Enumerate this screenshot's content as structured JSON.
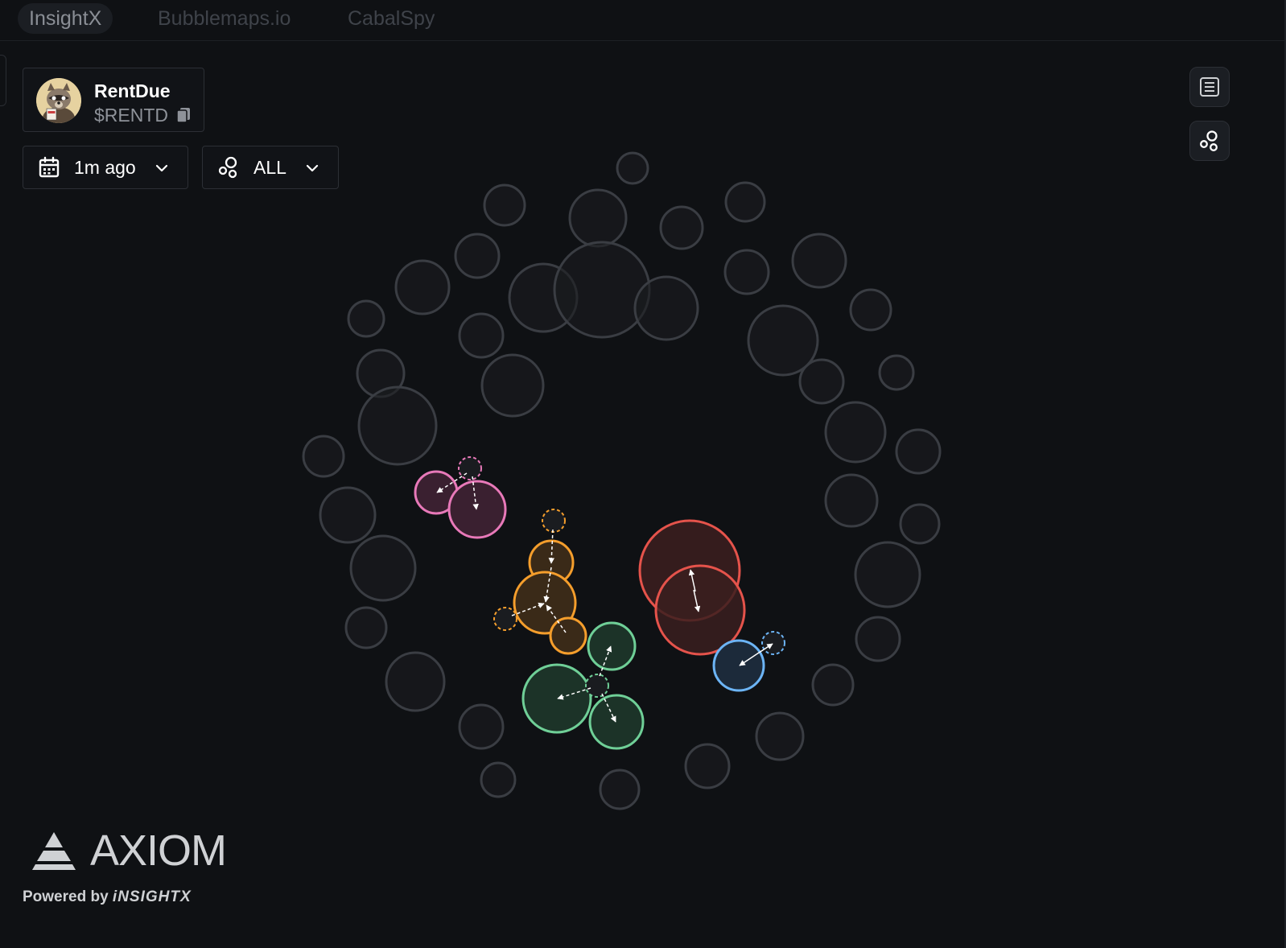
{
  "tabs": [
    {
      "label": "InsightX",
      "active": true
    },
    {
      "label": "Bubblemaps.io",
      "active": false
    },
    {
      "label": "CabalSpy",
      "active": false
    }
  ],
  "token": {
    "name": "RentDue",
    "symbol": "$RENTD",
    "avatar_icon": "raccoon-avatar-icon",
    "copy_icon": "copy-icon"
  },
  "filters": {
    "time": {
      "label": "1m ago",
      "icon": "calendar-icon"
    },
    "type": {
      "label": "ALL",
      "icon": "bubbles-icon"
    }
  },
  "side_buttons": [
    {
      "icon": "list-icon"
    },
    {
      "icon": "bubbles-icon"
    }
  ],
  "branding": {
    "name": "AXIOM",
    "powered_prefix": "Powered by ",
    "powered_brand": "iNSIGHTX"
  },
  "colors": {
    "background": "#0f1114",
    "bubble_gray": "#3a3d43",
    "cluster_pink": "#e879b9",
    "cluster_orange": "#f59e2c",
    "cluster_red": "#e5534b",
    "cluster_green": "#6fcf97",
    "cluster_blue": "#6cb4f5"
  }
}
